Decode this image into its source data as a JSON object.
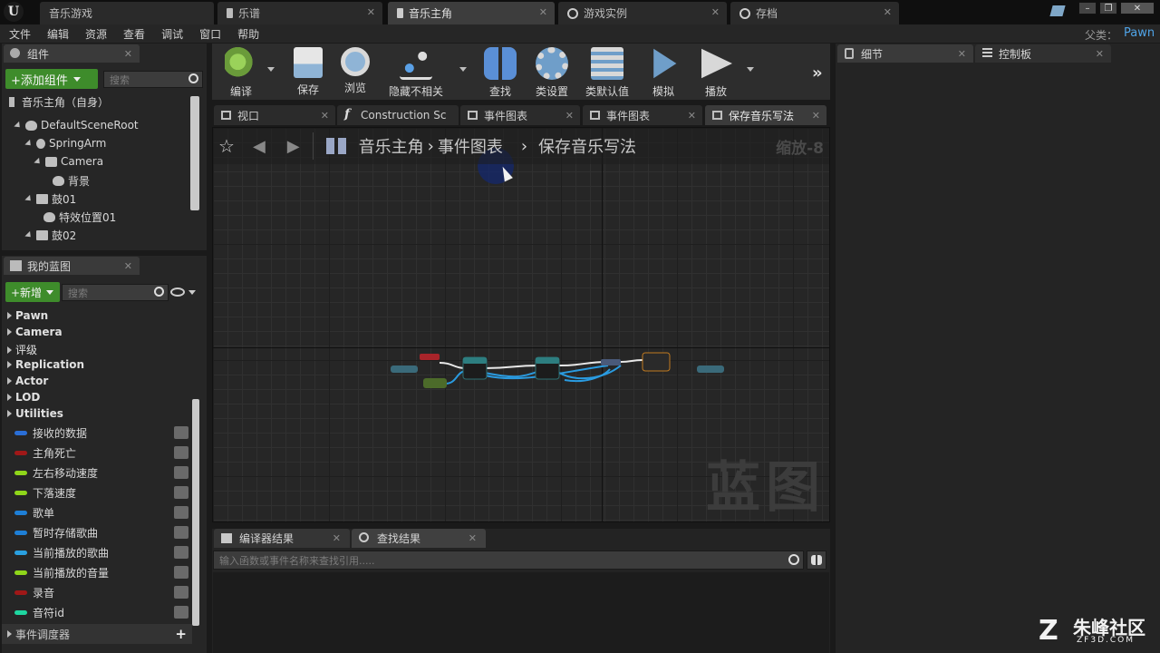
{
  "document_tabs": [
    {
      "label": "音乐游戏"
    },
    {
      "label": "乐谱"
    },
    {
      "label": "音乐主角"
    },
    {
      "label": "游戏实例"
    },
    {
      "label": "存档"
    }
  ],
  "menu": [
    "文件",
    "编辑",
    "资源",
    "查看",
    "调试",
    "窗口",
    "帮助"
  ],
  "parent_class": {
    "label": "父类：",
    "value": "Pawn"
  },
  "components_panel": {
    "title": "组件",
    "add_button": "+添加组件",
    "search_placeholder": "搜索",
    "self_item": "音乐主角（自身）",
    "tree": [
      {
        "label": "DefaultSceneRoot"
      },
      {
        "label": "SpringArm"
      },
      {
        "label": "Camera"
      },
      {
        "label": "背景"
      },
      {
        "label": "鼓01"
      },
      {
        "label": "特效位置01"
      },
      {
        "label": "鼓02"
      }
    ]
  },
  "my_blueprint_panel": {
    "title": "我的蓝图",
    "new_button": "+新增",
    "search_placeholder": "搜索",
    "categories": [
      "Pawn",
      "Camera",
      "评级",
      "Replication",
      "Actor",
      "LOD",
      "Utilities"
    ],
    "variables": [
      {
        "label": "接收的数据",
        "color": "#2a6ed6"
      },
      {
        "label": "主角死亡",
        "color": "#a01818"
      },
      {
        "label": "左右移动速度",
        "color": "#8fd61a"
      },
      {
        "label": "下落速度",
        "color": "#8fd61a"
      },
      {
        "label": "歌单",
        "color": "#1e7fd6"
      },
      {
        "label": "暂时存储歌曲",
        "color": "#1e7fd6"
      },
      {
        "label": "当前播放的歌曲",
        "color": "#2aa0e0"
      },
      {
        "label": "当前播放的音量",
        "color": "#8fd61a"
      },
      {
        "label": "录音",
        "color": "#a01818"
      },
      {
        "label": "音符id",
        "color": "#1ed6a0"
      }
    ],
    "event_dispatchers": "事件调度器"
  },
  "toolbar": [
    {
      "label": "编译"
    },
    {
      "label": "保存"
    },
    {
      "label": "浏览"
    },
    {
      "label": "隐藏不相关"
    },
    {
      "label": "查找"
    },
    {
      "label": "类设置"
    },
    {
      "label": "类默认值"
    },
    {
      "label": "模拟"
    },
    {
      "label": "播放"
    }
  ],
  "graph_tabs": [
    {
      "label": "视口"
    },
    {
      "label": "Construction Sc"
    },
    {
      "label": "事件图表"
    },
    {
      "label": "事件图表"
    },
    {
      "label": "保存音乐写法"
    }
  ],
  "breadcrumb": {
    "root": "音乐主角",
    "middle": "事件图表",
    "current": "保存音乐写法",
    "zoom": "缩放-8"
  },
  "watermark": "蓝图",
  "right_panels": {
    "details": "细节",
    "palette": "控制板"
  },
  "bottom_tabs": [
    {
      "label": "编译器结果"
    },
    {
      "label": "查找结果"
    }
  ],
  "find_results": {
    "search_placeholder": "输入函数或事件名称来查找引用....."
  },
  "site_watermark": {
    "name": "朱峰社区",
    "url": "ZF3D.COM"
  },
  "colors": {
    "accent_green": "#3e8c2b",
    "graph_bg": "#262626",
    "exec_wire": "#e8e8e8",
    "data_wire": "#2a9be0"
  }
}
